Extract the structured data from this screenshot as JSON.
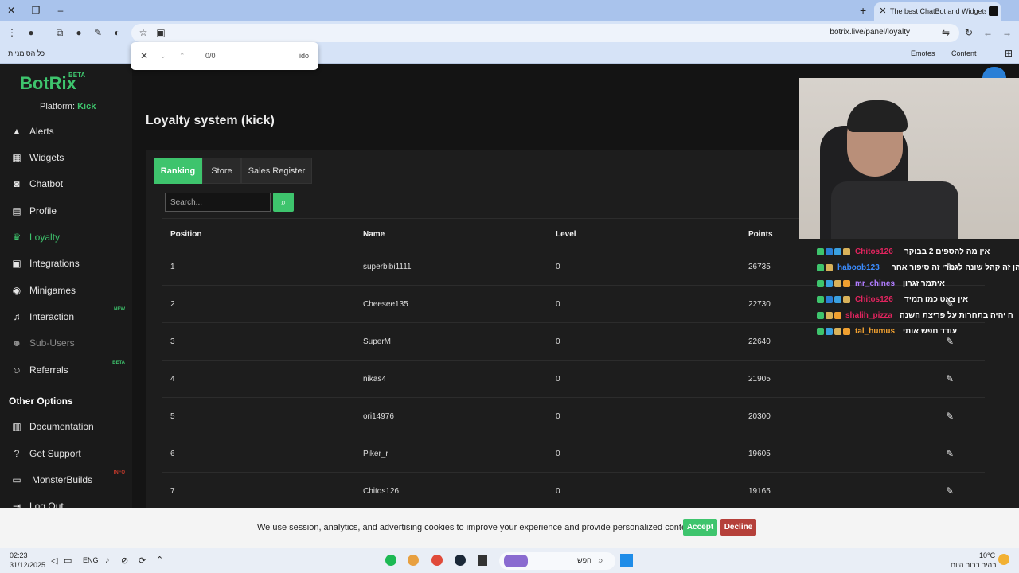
{
  "browser": {
    "tab_title": "The best ChatBot and Widgets",
    "new_tab_label": "+",
    "url": "botrix.live/panel/loyalty",
    "bookmarks": {
      "all_bookmarks": "כל הסימניות",
      "emotes": "Emotes",
      "content": "Content"
    },
    "find": {
      "count": "0/0",
      "query": "ido"
    }
  },
  "sidebar": {
    "logo": "BotRix",
    "logo_badge": "BETA",
    "platform_label": "Platform:",
    "platform_value": "Kick",
    "items": [
      {
        "label": "Alerts",
        "icon": "warning-icon"
      },
      {
        "label": "Widgets",
        "icon": "grid-icon"
      },
      {
        "label": "Chatbot",
        "icon": "robot-icon"
      },
      {
        "label": "Profile",
        "icon": "id-card-icon"
      },
      {
        "label": "Loyalty",
        "icon": "trophy-icon",
        "active": true
      },
      {
        "label": "Integrations",
        "icon": "puzzle-icon"
      },
      {
        "label": "Minigames",
        "icon": "gamepad-icon"
      },
      {
        "label": "Interaction",
        "icon": "music-icon",
        "badge": "NEW"
      },
      {
        "label": "Sub-Users",
        "icon": "users-icon",
        "disabled": true
      },
      {
        "label": "Referrals",
        "icon": "user-plus-icon",
        "badge": "BETA"
      }
    ],
    "section_title": "Other Options",
    "other_items": [
      {
        "label": "Documentation",
        "icon": "book-icon"
      },
      {
        "label": "Get Support",
        "icon": "question-icon"
      },
      {
        "label": "MonsterBuilds",
        "icon": "laptop-icon",
        "badge": "INFO"
      },
      {
        "label": "Log Out",
        "icon": "logout-icon"
      }
    ]
  },
  "main": {
    "heading": "Loyalty system (kick)",
    "tabs": [
      "Ranking",
      "Store",
      "Sales Register"
    ],
    "search_placeholder": "Search...",
    "columns": [
      "Position",
      "Name",
      "Level",
      "Points"
    ],
    "rows": [
      {
        "position": "1",
        "name": "superbibi1111",
        "level": "0",
        "points": "26735"
      },
      {
        "position": "2",
        "name": "Cheesee135",
        "level": "0",
        "points": "22730"
      },
      {
        "position": "3",
        "name": "SuperM",
        "level": "0",
        "points": "22640"
      },
      {
        "position": "4",
        "name": "nikas4",
        "level": "0",
        "points": "21905"
      },
      {
        "position": "5",
        "name": "ori14976",
        "level": "0",
        "points": "20300"
      },
      {
        "position": "6",
        "name": "Piker_r",
        "level": "0",
        "points": "19605"
      },
      {
        "position": "7",
        "name": "Chitos126",
        "level": "0",
        "points": "19165"
      }
    ]
  },
  "chat_overlay": {
    "messages": [
      {
        "user": "Chitos126",
        "color": "#e0245e",
        "text": "אין מה להספים 2 בבוקר"
      },
      {
        "user": "haboob123",
        "color": "#3b8cff",
        "text": "הן זה קהל שונה לגמרי זה סיפור אחר"
      },
      {
        "user": "mr_chines",
        "color": "#b07cff",
        "text": "איתמר זגרון"
      },
      {
        "user": "Chitos126",
        "color": "#e0245e",
        "text": "אין צאט כמו תמיד"
      },
      {
        "user": "shalih_pizza",
        "color": "#e0245e",
        "text": "ה יהיה בתחרות על פריצת השנה"
      },
      {
        "user": "tal_humus",
        "color": "#f0a030",
        "text": "עודד חפש אותי"
      }
    ]
  },
  "cookie": {
    "text": "We use session, analytics, and advertising cookies to improve your experience and provide personalized content.",
    "accept": "Accept",
    "decline": "Decline"
  },
  "taskbar": {
    "time": "02:23",
    "date": "31/12/2025",
    "lang": "ENG",
    "search_placeholder": "חפש",
    "weather_temp": "10°C",
    "weather_text": "בהיר ברוב היום"
  },
  "colors": {
    "accent": "#3ec46d",
    "decline": "#c0392b"
  }
}
